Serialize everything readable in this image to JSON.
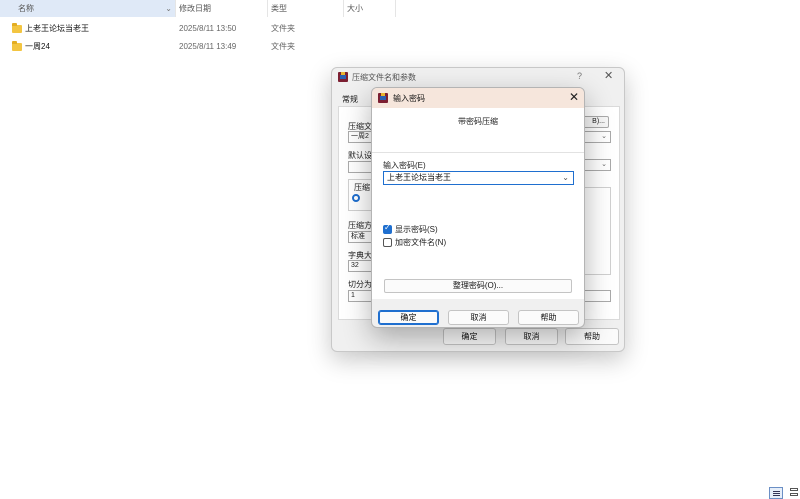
{
  "explorer": {
    "columns": {
      "name": "名称",
      "date": "修改日期",
      "type": "类型",
      "size": "大小"
    },
    "files": [
      {
        "name": "上老王论坛当老王",
        "date": "2025/8/11 13:50",
        "type": "文件夹"
      },
      {
        "name": "一周24",
        "date": "2025/8/11 13:49",
        "type": "文件夹"
      }
    ]
  },
  "archive_dialog": {
    "title": "压缩文件名和参数",
    "help": "?",
    "close": "✕",
    "tab_general": "常规",
    "archive_name_label": "压缩文",
    "archive_name_value": "一周2",
    "browse_button": "B)...",
    "default_profile_label": "默认设",
    "format_group": "压缩",
    "method_label": "压缩方",
    "method_value": "标准",
    "dictionary_label": "字典大",
    "dictionary_value": "32",
    "split_label": "切分为",
    "split_value": "1",
    "ok_button": "确定",
    "cancel_button": "取消",
    "help_button": "帮助"
  },
  "password_dialog": {
    "title": "输入密码",
    "close": "✕",
    "heading": "带密码压缩",
    "password_label": "输入密码(E)",
    "password_value": "上老王论坛当老王",
    "show_password_label": "显示密码(S)",
    "show_password_checked": true,
    "encrypt_names_label": "加密文件名(N)",
    "encrypt_names_checked": false,
    "organize_button": "整理密码(O)...",
    "ok_button": "确定",
    "cancel_button": "取消",
    "help_button": "帮助"
  }
}
